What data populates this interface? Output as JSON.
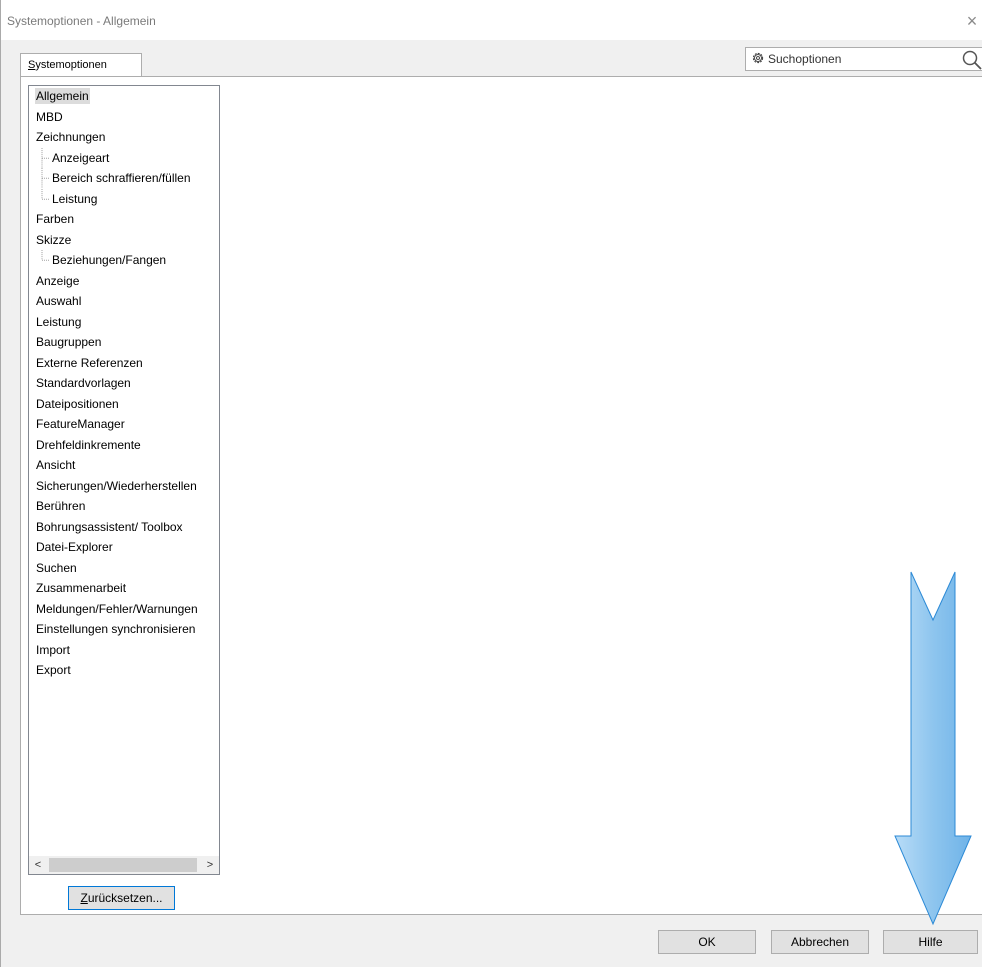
{
  "window": {
    "title": "Systemoptionen - Allgemein",
    "close_glyph": "×"
  },
  "tabs": [
    {
      "label_first": "S",
      "label_rest": "ystemoptionen",
      "active": true
    }
  ],
  "search": {
    "placeholder": "Suchoptionen",
    "value": "",
    "left_icon": "gear-icon",
    "right_icon": "magnifier-icon"
  },
  "tree": {
    "items": [
      {
        "label": "Allgemein",
        "level": 0,
        "selected": true
      },
      {
        "label": "MBD",
        "level": 0
      },
      {
        "label": "Zeichnungen",
        "level": 0
      },
      {
        "label": "Anzeigeart",
        "level": 1
      },
      {
        "label": "Bereich schraffieren/füllen",
        "level": 1
      },
      {
        "label": "Leistung",
        "level": 1,
        "last": true
      },
      {
        "label": "Farben",
        "level": 0
      },
      {
        "label": "Skizze",
        "level": 0
      },
      {
        "label": "Beziehungen/Fangen",
        "level": 1,
        "last": true
      },
      {
        "label": "Anzeige",
        "level": 0
      },
      {
        "label": "Auswahl",
        "level": 0
      },
      {
        "label": "Leistung",
        "level": 0
      },
      {
        "label": "Baugruppen",
        "level": 0
      },
      {
        "label": "Externe Referenzen",
        "level": 0
      },
      {
        "label": "Standardvorlagen",
        "level": 0
      },
      {
        "label": "Dateipositionen",
        "level": 0
      },
      {
        "label": "FeatureManager",
        "level": 0
      },
      {
        "label": "Drehfeldinkremente",
        "level": 0
      },
      {
        "label": "Ansicht",
        "level": 0
      },
      {
        "label": "Sicherungen/Wiederherstellen",
        "level": 0
      },
      {
        "label": "Berühren",
        "level": 0
      },
      {
        "label": "Bohrungsassistent/ Toolbox",
        "level": 0
      },
      {
        "label": "Datei-Explorer",
        "level": 0
      },
      {
        "label": "Suchen",
        "level": 0
      },
      {
        "label": "Zusammenarbeit",
        "level": 0
      },
      {
        "label": "Meldungen/Fehler/Warnungen",
        "level": 0
      },
      {
        "label": "Einstellungen synchronisieren",
        "level": 0
      },
      {
        "label": "Import",
        "level": 0
      },
      {
        "label": "Export",
        "level": 0
      }
    ],
    "scroll_left": "<",
    "scroll_right": ">"
  },
  "buttons": {
    "reset": {
      "accel": "Z",
      "rest": "urücksetzen..."
    },
    "ok": "OK",
    "cancel": "Abbrechen",
    "help": "Hilfe"
  },
  "colors": {
    "arrow_fill": "#8ec5ee",
    "arrow_stroke": "#2c8ad6",
    "focus_border": "#0078d7"
  }
}
